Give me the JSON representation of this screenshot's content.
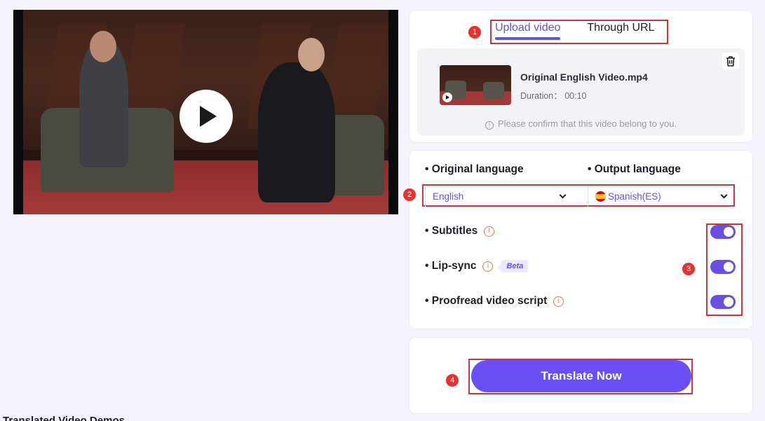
{
  "video_player": {
    "play_icon": "play-icon"
  },
  "upload_card": {
    "tabs": [
      {
        "label": "Upload video",
        "active": true
      },
      {
        "label": "Through URL",
        "active": false
      }
    ],
    "file": {
      "name": "Original English Video.mp4",
      "duration": "Duration： 00:10"
    },
    "confirm_note": "Please confirm that this video belong to you.",
    "icons": {
      "delete": "trash-icon",
      "info": "info-icon",
      "thumb_play": "play-icon"
    }
  },
  "settings_card": {
    "original_language_label": "• Original language",
    "output_language_label": "• Output language",
    "original_language_value": "English",
    "output_language_value": "Spanish(ES)",
    "options": [
      {
        "label": "• Subtitles",
        "enabled": true,
        "badge": null
      },
      {
        "label": "• Lip-sync",
        "enabled": true,
        "badge": "Beta"
      },
      {
        "label": "• Proofread video script",
        "enabled": true,
        "badge": null
      }
    ]
  },
  "action_card": {
    "translate_label": "Translate Now"
  },
  "annotations": [
    "1",
    "2",
    "3",
    "4"
  ],
  "bottom_heading": "Translated Video Demos",
  "colors": {
    "accent": "#6a4fe6",
    "button": "#6a4ff6",
    "annotation_red": "#d0353c",
    "info_orange": "#e07a4f",
    "page_bg": "#f5f3fb"
  }
}
